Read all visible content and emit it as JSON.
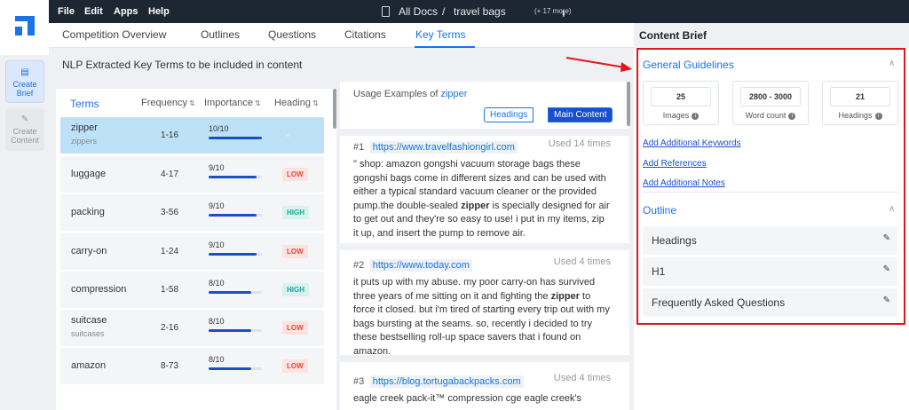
{
  "menu": {
    "items": [
      "File",
      "Edit",
      "Apps",
      "Help"
    ]
  },
  "breadcrumb": {
    "root": "All Docs",
    "separator": "/",
    "doc": "travel bags",
    "more": "(+ 17 more)"
  },
  "rail": {
    "create_brief": "Create Brief",
    "create_content": "Create Content"
  },
  "tabs": [
    "Competition Overview",
    "Outlines",
    "Questions",
    "Citations",
    "Key Terms"
  ],
  "active_tab": "Key Terms",
  "nlp_title": "NLP Extracted Key Terms to be included in content",
  "table": {
    "headers": {
      "terms": "Terms",
      "frequency": "Frequency",
      "importance": "Importance",
      "heading": "Heading"
    },
    "rows": [
      {
        "term": "zipper",
        "sub": "zippers",
        "freq": "1-16",
        "imp": "10/10",
        "imp_value": 1.0,
        "heading": "-",
        "status": "none"
      },
      {
        "term": "luggage",
        "sub": "",
        "freq": "4-17",
        "imp": "9/10",
        "imp_value": 0.9,
        "heading": "LOW",
        "status": "low"
      },
      {
        "term": "packing",
        "sub": "",
        "freq": "3-56",
        "imp": "9/10",
        "imp_value": 0.9,
        "heading": "HIGH",
        "status": "high"
      },
      {
        "term": "carry-on",
        "sub": "",
        "freq": "1-24",
        "imp": "9/10",
        "imp_value": 0.9,
        "heading": "LOW",
        "status": "low"
      },
      {
        "term": "compression",
        "sub": "",
        "freq": "1-58",
        "imp": "8/10",
        "imp_value": 0.8,
        "heading": "HIGH",
        "status": "high"
      },
      {
        "term": "suitcase",
        "sub": "suitcases",
        "freq": "2-16",
        "imp": "8/10",
        "imp_value": 0.8,
        "heading": "LOW",
        "status": "low"
      },
      {
        "term": "amazon",
        "sub": "",
        "freq": "8-73",
        "imp": "8/10",
        "imp_value": 0.8,
        "heading": "LOW",
        "status": "low"
      }
    ]
  },
  "usage": {
    "label": "Usage Examples of",
    "term": "zipper",
    "toggle_headings": "Headings",
    "toggle_main": "Main Content",
    "examples": [
      {
        "num": "#1",
        "url": "https://www.travelfashiongirl.com",
        "used": "Used 14 times",
        "before": "\" shop: amazon gongshi vacuum storage bags these gongshi bags come in different sizes and can be used with either a typical standard vacuum cleaner or the provided pump.the double-sealed ",
        "highlight": "zipper",
        "after": " is specially designed for air to get out and they're so easy to use! i put in my items, zip it up, and insert the pump to remove air."
      },
      {
        "num": "#2",
        "url": "https://www.today.com",
        "used": "Used 4 times",
        "before": "it puts up with my abuse. my poor carry-on has survived three years of me sitting on it and fighting the ",
        "highlight": "zipper",
        "after": " to force it closed. but i'm tired of starting every trip out with my bags bursting at the seams. so, recently i decided to try these bestselling roll-up space savers that i found on amazon."
      },
      {
        "num": "#3",
        "url": "https://blog.tortugabackpacks.com",
        "used": "Used 4 times",
        "before": "eagle creek pack-it™ compression cge eagle creek's",
        "highlight": "",
        "after": ""
      }
    ]
  },
  "brief": {
    "title": "Content Brief",
    "general_title": "General Guidelines",
    "stats": [
      {
        "value": "25",
        "label": "Images"
      },
      {
        "value": "2800 - 3000",
        "label": "Word count"
      },
      {
        "value": "21",
        "label": "Headings"
      }
    ],
    "links": [
      "Add Additional Keywords",
      "Add References",
      "Add Additional Notes"
    ],
    "outline_title": "Outline",
    "outline_items": [
      "Headings",
      "H1",
      "Frequently Asked Questions"
    ]
  },
  "colors": {
    "accent": "#1a73e8",
    "annotation": "#e8141c",
    "topbar": "#1c2733"
  }
}
